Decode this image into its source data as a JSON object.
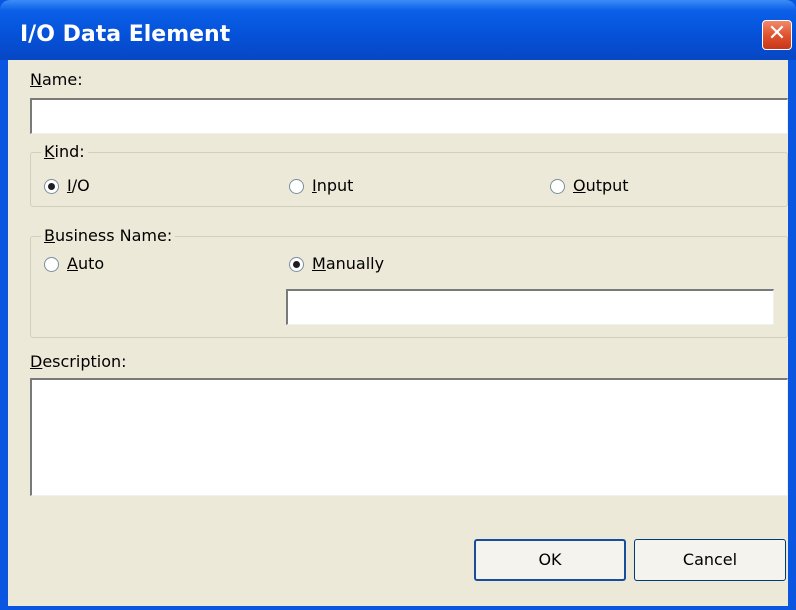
{
  "window": {
    "title": "I/O Data Element"
  },
  "name_field": {
    "label_underlined": "N",
    "label_rest": "ame:",
    "value": ""
  },
  "kind": {
    "legend_underlined": "K",
    "legend_rest": "ind:",
    "options": [
      {
        "underlined": "I",
        "rest": "/O",
        "checked": true
      },
      {
        "underlined": "I",
        "rest": "nput",
        "checked": false
      },
      {
        "underlined": "O",
        "rest": "utput",
        "checked": false
      }
    ]
  },
  "business_name": {
    "legend_underlined": "B",
    "legend_rest": "usiness Name:",
    "auto": {
      "underlined": "A",
      "rest": "uto",
      "checked": false
    },
    "manually": {
      "underlined": "M",
      "rest": "anually",
      "checked": true
    },
    "manual_value": ""
  },
  "description": {
    "label_underlined": "D",
    "label_rest": "escription:",
    "value": ""
  },
  "buttons": {
    "ok": "OK",
    "cancel": "Cancel"
  },
  "icons": {
    "close": "close-icon"
  }
}
